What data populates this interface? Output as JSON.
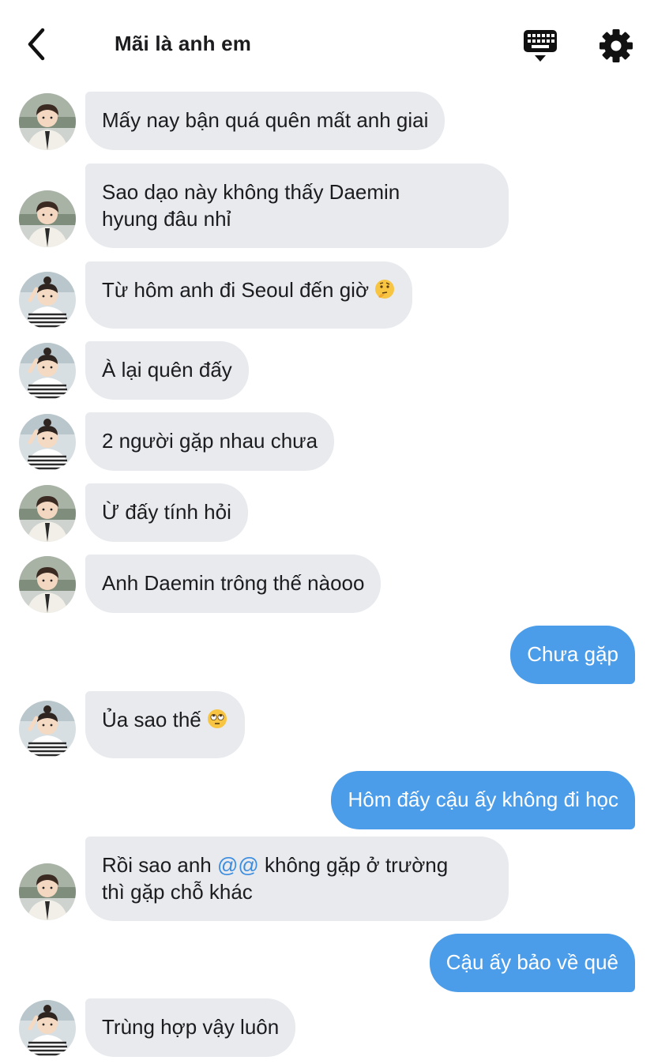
{
  "header": {
    "title": "Mãi là anh em",
    "back_icon": "chevron-left-icon",
    "keyboard_icon": "keyboard-icon",
    "settings_icon": "gear-icon"
  },
  "colors": {
    "incoming_bubble": "#e8eaee",
    "outgoing_bubble": "#4b9de9",
    "mention": "#3c8de0"
  },
  "messages": [
    {
      "direction": "in",
      "avatar": "avatar-boy-jacket",
      "text": "Mấy nay bận quá quên mất anh giai"
    },
    {
      "direction": "in",
      "avatar": "avatar-boy-jacket",
      "text_line1": "Sao dạo này không thấy Daemin",
      "text_line2": "hyung đâu nhỉ"
    },
    {
      "direction": "in",
      "avatar": "avatar-boy-striped",
      "text": "Từ hôm anh đi Seoul đến giờ",
      "emoji": "thinking-face"
    },
    {
      "direction": "in",
      "avatar": "avatar-boy-striped",
      "text": "À lại quên đấy"
    },
    {
      "direction": "in",
      "avatar": "avatar-boy-striped",
      "text": "2 người gặp nhau chưa"
    },
    {
      "direction": "in",
      "avatar": "avatar-boy-jacket",
      "text": "Ừ đấy tính hỏi"
    },
    {
      "direction": "in",
      "avatar": "avatar-boy-jacket",
      "text": "Anh Daemin trông thế nàooo"
    },
    {
      "direction": "out",
      "text": "Chưa gặp"
    },
    {
      "direction": "in",
      "avatar": "avatar-boy-striped",
      "text": "Ủa sao thế",
      "emoji": "rolling-eyes-face"
    },
    {
      "direction": "out",
      "text": "Hôm đấy cậu ấy không đi học"
    },
    {
      "direction": "in",
      "avatar": "avatar-boy-jacket",
      "text_before": "Rồi sao anh ",
      "mention": "@@",
      "text_after": " không gặp ở trường",
      "text_line2": "thì gặp chỗ khác"
    },
    {
      "direction": "out",
      "text": "Cậu ấy bảo về quê"
    },
    {
      "direction": "in",
      "avatar": "avatar-boy-striped",
      "text": "Trùng hợp vậy luôn"
    }
  ]
}
